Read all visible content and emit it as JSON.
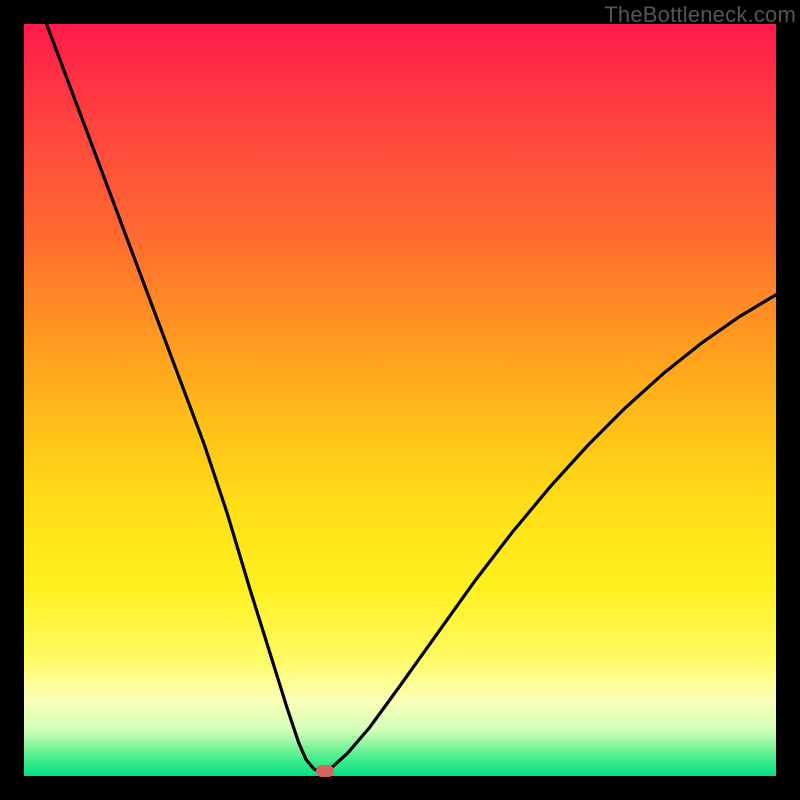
{
  "watermark": "TheBottleneck.com",
  "chart_data": {
    "type": "line",
    "title": "",
    "xlabel": "",
    "ylabel": "",
    "xlim": [
      0,
      100
    ],
    "ylim": [
      0,
      100
    ],
    "x": [
      3,
      6,
      9,
      12,
      15,
      18,
      21,
      24,
      27,
      30,
      32.5,
      35,
      36.5,
      37.5,
      38.5,
      39,
      39.5,
      40,
      41,
      43,
      46,
      50,
      55,
      60,
      65,
      70,
      75,
      80,
      85,
      90,
      95,
      100
    ],
    "y": [
      100,
      92,
      84,
      76,
      68,
      60,
      52,
      44,
      35,
      25,
      17,
      9,
      4.5,
      2.2,
      1.0,
      0.7,
      0.6,
      0.7,
      1.2,
      3.0,
      6.5,
      12,
      19,
      26,
      32.5,
      38.5,
      44,
      49,
      53.5,
      57.5,
      61,
      64
    ],
    "marker": {
      "x": 40,
      "y": 0.6
    },
    "colors": {
      "top": "#ff1a4a",
      "mid": "#ffe018",
      "bottom": "#00e080",
      "line": "#000000",
      "marker": "#d5645f",
      "frame": "#000000"
    }
  }
}
